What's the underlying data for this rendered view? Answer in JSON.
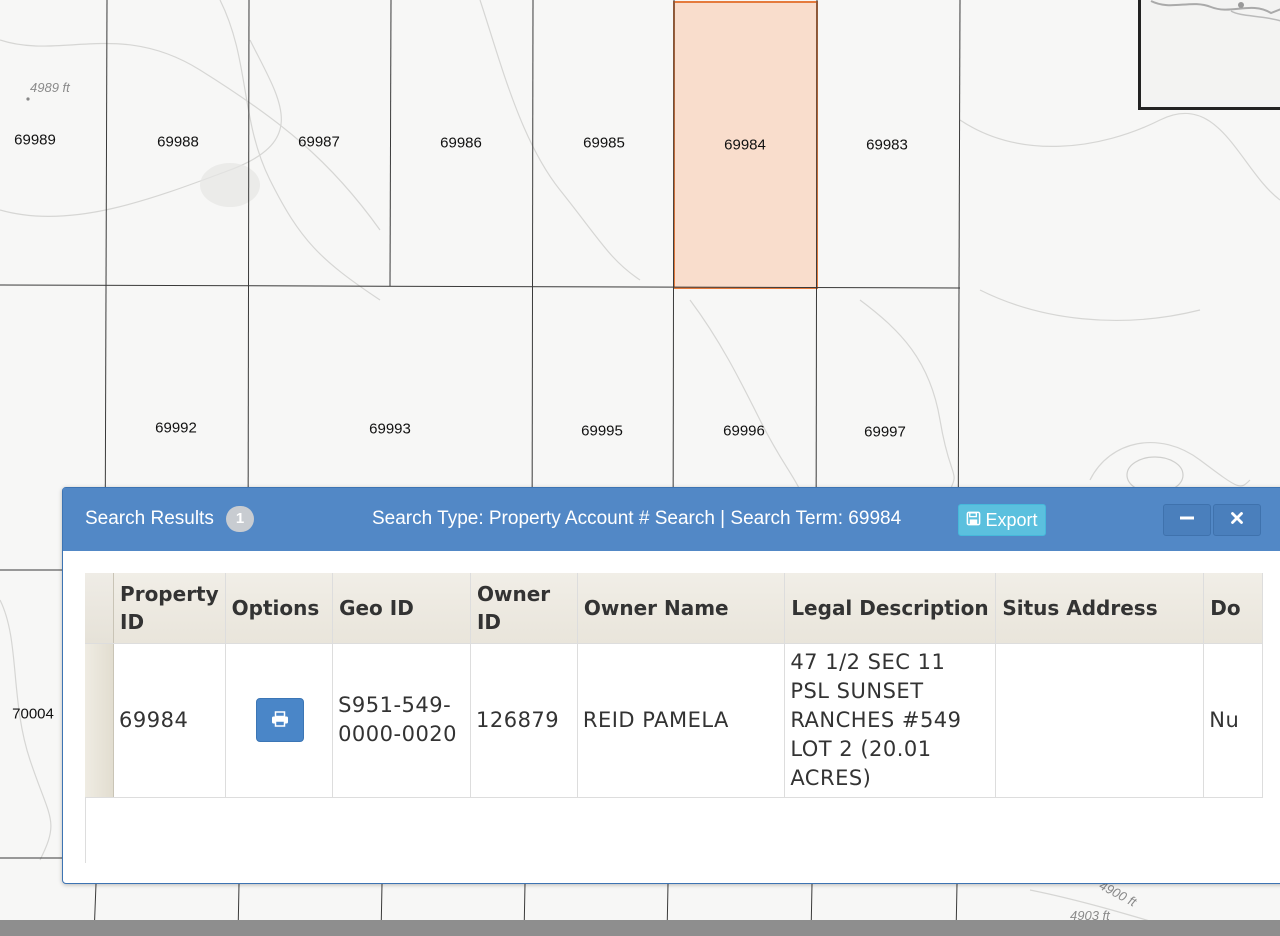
{
  "map": {
    "parcels": [
      "69989",
      "69988",
      "69987",
      "69986",
      "69985",
      "69984",
      "69983",
      "69992",
      "69993",
      "69995",
      "69996",
      "69997",
      "70004"
    ],
    "selected_parcel": "69984",
    "elevation_labels": [
      "4989 ft",
      "4900 ft",
      "4903 ft"
    ],
    "colors": {
      "selected_fill": "#f9ddcc",
      "selected_stroke": "#e57a3c",
      "parcel_line": "#3a3a3a",
      "contour": "#d2d2d0"
    }
  },
  "panel": {
    "title": "Search Results",
    "count": "1",
    "search_info": "Search Type: Property Account # Search | Search Term: 69984",
    "export_label": "Export",
    "minimize_icon": "minus-icon",
    "close_icon": "close-icon",
    "colors": {
      "header": "#5288c6",
      "export": "#5bc0de",
      "print_button": "#4a86c8"
    }
  },
  "table": {
    "columns": [
      "Property ID",
      "Options",
      "Geo ID",
      "Owner ID",
      "Owner Name",
      "Legal Description",
      "Situs Address",
      "Do"
    ],
    "rows": [
      {
        "property_id": "69984",
        "options_icon": "print-icon",
        "geo_id": "S951-549-0000-0020",
        "owner_id": "126879",
        "owner_name": "REID PAMELA",
        "legal_description": "47 1/2 SEC 11 PSL SUNSET RANCHES #549 LOT 2 (20.01 ACRES)",
        "situs_address": "",
        "do": "Nu"
      }
    ]
  }
}
